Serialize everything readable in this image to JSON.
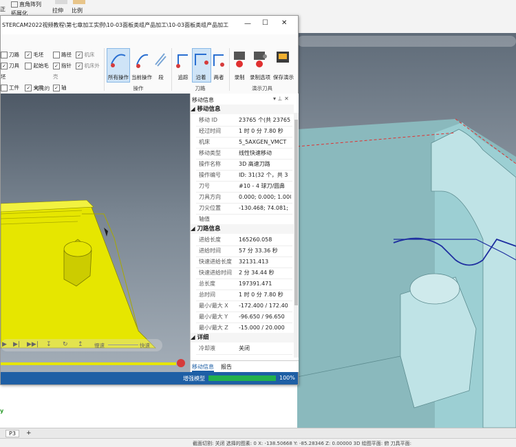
{
  "bg_ribbon": {
    "fillet_array": "直角阵列",
    "normalize": "拓展化",
    "stretch": "拉伸",
    "scale": "比例",
    "edge_label": "正"
  },
  "window": {
    "title": "STERCAM2022视频教程\\第七章加工实例\\10-03面板类组产品加工\\10-03面板类组产品加工...",
    "minimize": "—",
    "maximize": "☐",
    "close": "✕"
  },
  "visible_group": {
    "checks": [
      {
        "label": "刀路",
        "checked": false
      },
      {
        "label": "毛坯",
        "checked": true
      },
      {
        "label": "刀具",
        "checked": true
      },
      {
        "label": "起始毛坯",
        "checked": false
      },
      {
        "label": "工件",
        "checked": false
      },
      {
        "label": "夹具",
        "checked": true
      }
    ],
    "checks2": [
      {
        "label": "路径",
        "checked": false
      },
      {
        "label": "机床",
        "checked": true
      },
      {
        "label": "指针",
        "checked": true
      },
      {
        "label": "机床外壳",
        "checked": true
      },
      {
        "label": "轴",
        "checked": true
      }
    ],
    "group_label": "可见的"
  },
  "operations_group": {
    "all_ops": "所有操作",
    "current_op": "当前操作",
    "segment": "段",
    "group_label": "操作"
  },
  "toolpath_group": {
    "trace": "追踪",
    "along": "沿着",
    "both": "两者",
    "group_label": "刀路"
  },
  "demo_group": {
    "record": "录制",
    "record_options": "录制选项",
    "save_demo": "保存演示",
    "group_label": "演示刀具"
  },
  "panel": {
    "title": "移动信息",
    "pin": "▾ ⊥ ✕",
    "section1": "移动信息",
    "rows1": [
      {
        "k": "移动 ID",
        "v": "23765 个(共 23765)"
      },
      {
        "k": "经过时间",
        "v": "1 时 0 分 7.80 秒"
      },
      {
        "k": "机床",
        "v": "5_5AXGEN_VMCT"
      },
      {
        "k": "移动类型",
        "v": "线性快速移动"
      },
      {
        "k": "操作名称",
        "v": "3D 高速刀路"
      },
      {
        "k": "操作编号",
        "v": "ID: 31(32 个，共 3"
      },
      {
        "k": "刀号",
        "v": "#10 - 4 球刀/圆鼻"
      },
      {
        "k": "刀具方向",
        "v": "0.000; 0.000; 1.000"
      },
      {
        "k": "刀尖位置",
        "v": "-130.468; 74.081;"
      },
      {
        "k": "轴值",
        "v": ""
      }
    ],
    "section2": "刀路信息",
    "rows2": [
      {
        "k": "进给长度",
        "v": "165260.058"
      },
      {
        "k": "进给时间",
        "v": "57 分 33.36 秒"
      },
      {
        "k": "快速进给长度",
        "v": "32131.413"
      },
      {
        "k": "快速进给时间",
        "v": "2 分 34.44 秒"
      },
      {
        "k": "总长度",
        "v": "197391.471"
      },
      {
        "k": "总时间",
        "v": "1 时 0 分 7.80 秒"
      },
      {
        "k": "最小/最大 X",
        "v": "-172.400 / 172.40"
      },
      {
        "k": "最小/最大 Y",
        "v": "-96.650 / 96.650"
      },
      {
        "k": "最小/最大 Z",
        "v": "-15.000 / 20.000"
      }
    ],
    "section3": "详细",
    "rows3": [
      {
        "k": "冷却液",
        "v": "关闭"
      }
    ],
    "tab_move": "移动信息",
    "tab_report": "报告"
  },
  "playback": {
    "slow": "慢速",
    "fast": "快速"
  },
  "status": {
    "label": "增强模型",
    "percent": "100%",
    "progress": 1.0
  },
  "bottom": {
    "tab": "P3",
    "add": "+",
    "status_text": "截面切割: 关闭    选择的图素: 0    X: -138.50668    Y: -85.28346    Z: 0.00000    3D    绘图平面: 俯    刀具平面:"
  },
  "colors": {
    "accent": "#1e5fa5",
    "progress": "#22b14c",
    "workpiece": "#e6e600",
    "part": "#a9d6d9"
  }
}
